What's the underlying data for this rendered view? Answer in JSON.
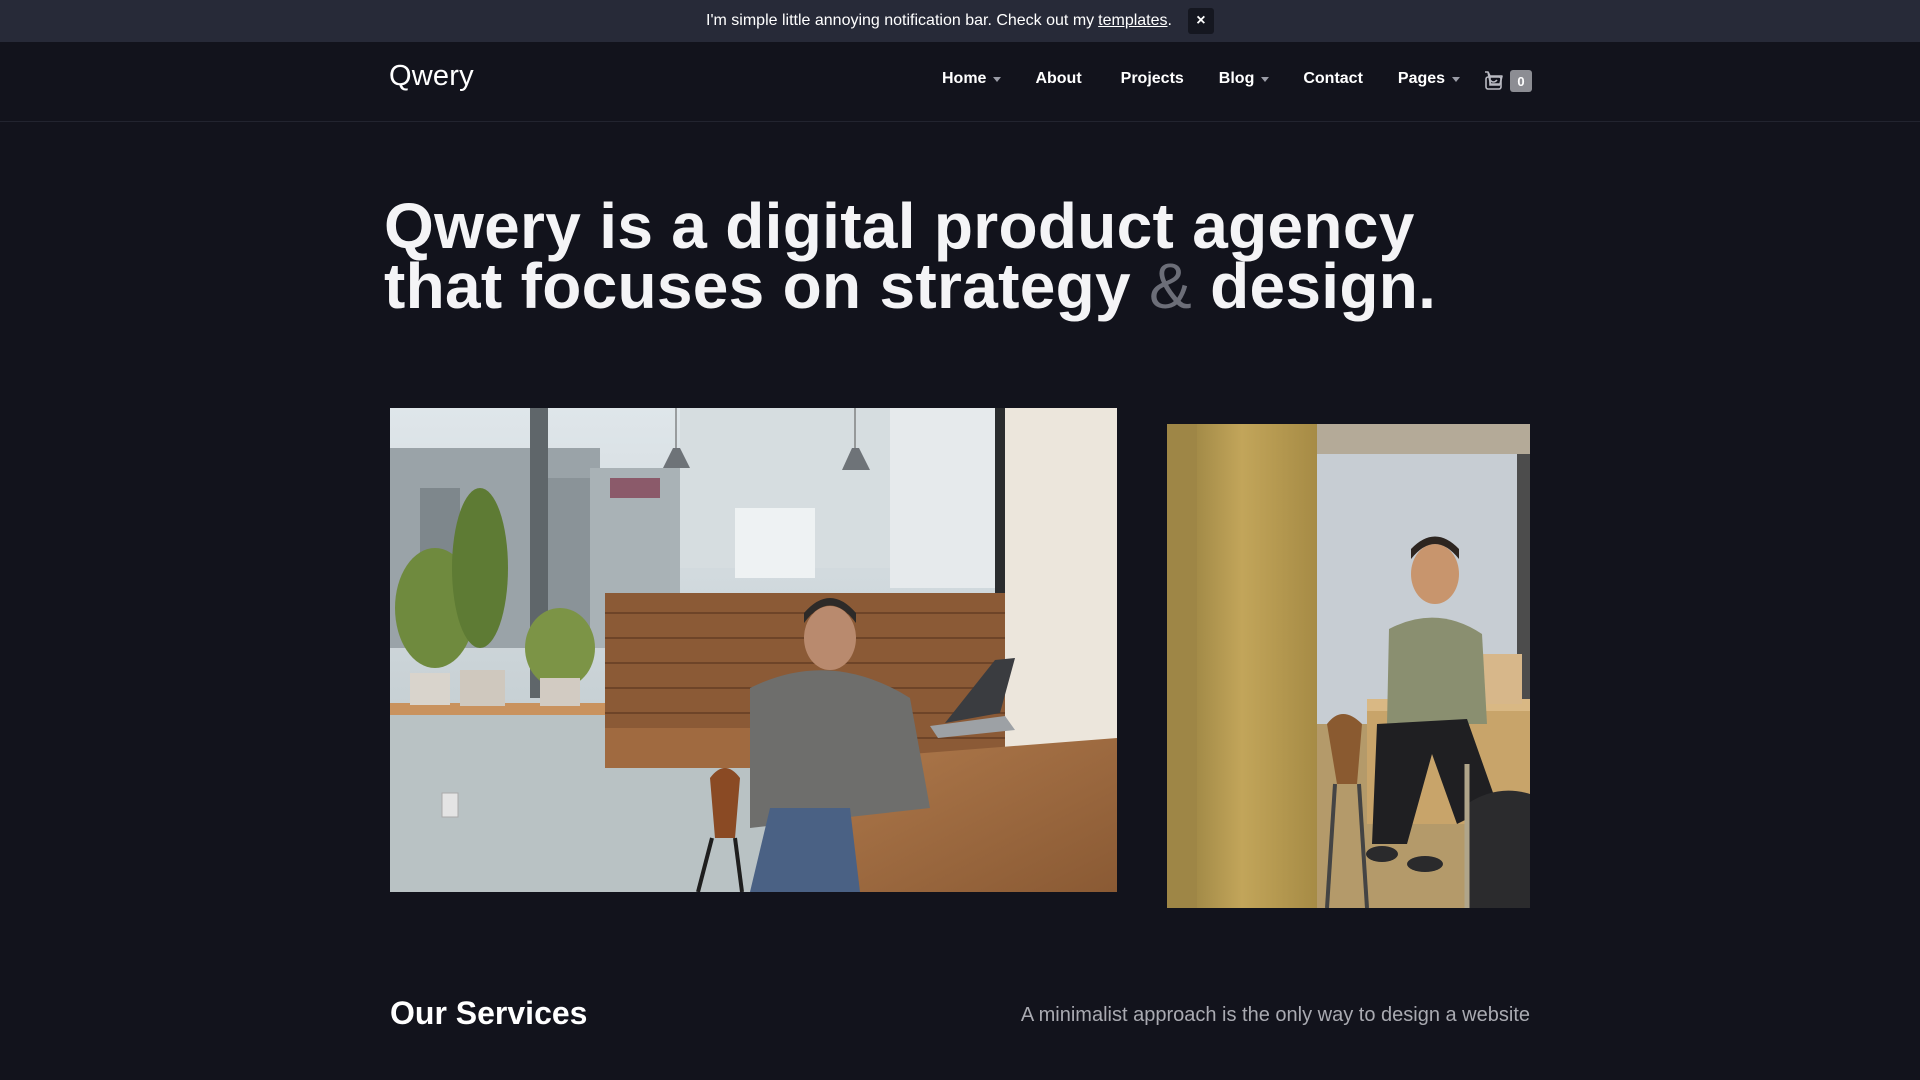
{
  "notification": {
    "message": "I'm simple little annoying notification bar. Check out my",
    "link_text": "templates",
    "suffix": ".",
    "close_label": "×"
  },
  "header": {
    "logo": "Qwery",
    "nav": [
      {
        "label": "Home",
        "has_dropdown": true
      },
      {
        "label": "About",
        "has_dropdown": false
      },
      {
        "label": "Projects",
        "has_dropdown": false
      },
      {
        "label": "Blog",
        "has_dropdown": true
      },
      {
        "label": "Contact",
        "has_dropdown": false
      },
      {
        "label": "Pages",
        "has_dropdown": true
      }
    ],
    "cart": {
      "icon": "cart-icon",
      "count": "0"
    }
  },
  "hero": {
    "line1": "Qwery is a digital product agency",
    "line2_a": "that focuses on strategy",
    "amp": "&",
    "line2_b": "design."
  },
  "services": {
    "title": "Our Services",
    "subtitle": "A minimalist approach is the only way to design a website"
  },
  "colors": {
    "background": "#12131c",
    "notification_bg": "#272a38",
    "muted_text": "#a9aab1",
    "amp_color": "#6c6e78"
  }
}
